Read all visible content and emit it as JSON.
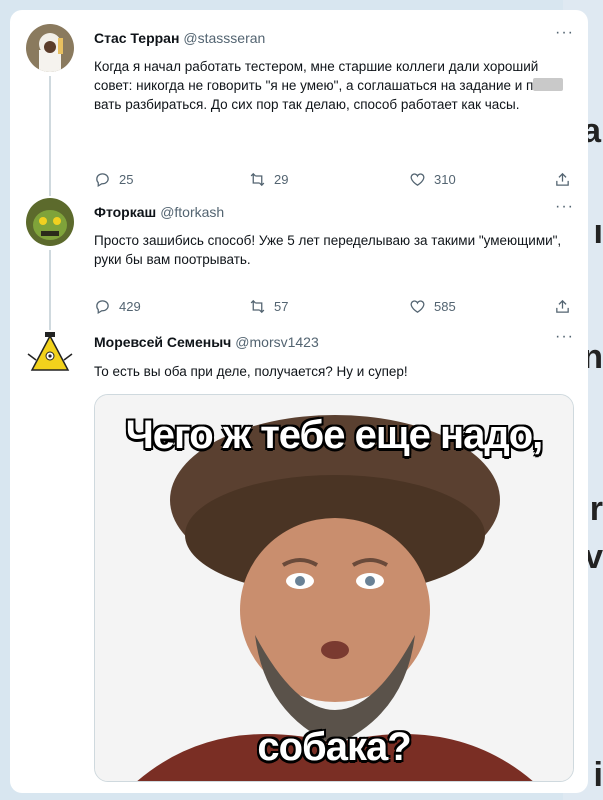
{
  "tweets": [
    {
      "name": "Стас Терран",
      "handle": "@stassseran",
      "text_before": "Когда я начал работать тестером, мне старшие коллеги дали хороший совет: никогда не говорить \"я не умею\", а соглашаться на задание и п",
      "text_after": "вать разбираться. До сих пор так делаю, способ работает как часы.",
      "replies": "25",
      "retweets": "29",
      "likes": "310"
    },
    {
      "name": "Фторкаш",
      "handle": "@ftorkash",
      "text": "Просто зашибись способ! Уже 5 лет переделываю за такими \"умеющими\", руки бы вам поотрывать.",
      "replies": "429",
      "retweets": "57",
      "likes": "585"
    },
    {
      "name": "Моревсей Семеныч",
      "handle": "@morsv1423",
      "text": "То есть вы оба при деле, получается? Ну и супер!"
    }
  ],
  "meme": {
    "caption_top": "Чего ж тебе еще надо,",
    "caption_bottom": "собака?"
  },
  "more_label": "···",
  "icons": [
    "reply-icon",
    "retweet-icon",
    "like-icon",
    "share-icon",
    "more-icon"
  ],
  "colors": {
    "muted": "#536471",
    "background": "#d8e6f0",
    "card": "#ffffff"
  }
}
